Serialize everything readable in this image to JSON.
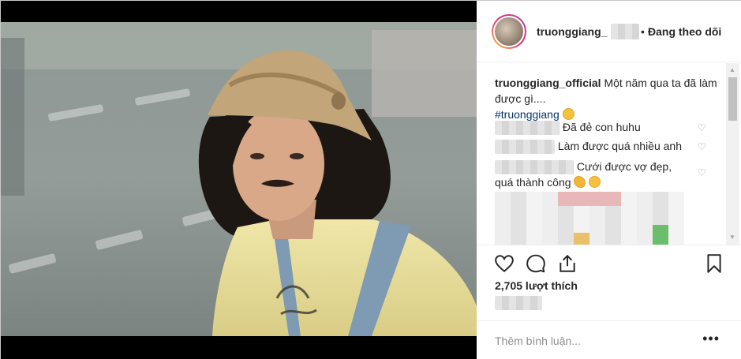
{
  "header": {
    "username": "truonggiang_",
    "separator": "•",
    "follow_status": "Đang theo dõi"
  },
  "caption": {
    "username": "truonggiang_official",
    "text": "Một năm qua ta đã làm được gì....",
    "hashtag": "#truonggiang"
  },
  "comments": [
    {
      "text": "Đã đẻ con huhu"
    },
    {
      "text": "Làm được quá nhiều anh"
    },
    {
      "text": "Cưới được vợ đẹp, quá thành công"
    }
  ],
  "actions": {
    "likes": "2,705 lượt thích",
    "add_comment_placeholder": "Thêm bình luận...",
    "more": "•••"
  },
  "icons": [
    "heart-icon",
    "comment-icon",
    "share-icon",
    "bookmark-icon",
    "more-icon"
  ],
  "colors": {
    "hashtag": "#003569",
    "text": "#262626",
    "muted": "#8e8e8e"
  }
}
